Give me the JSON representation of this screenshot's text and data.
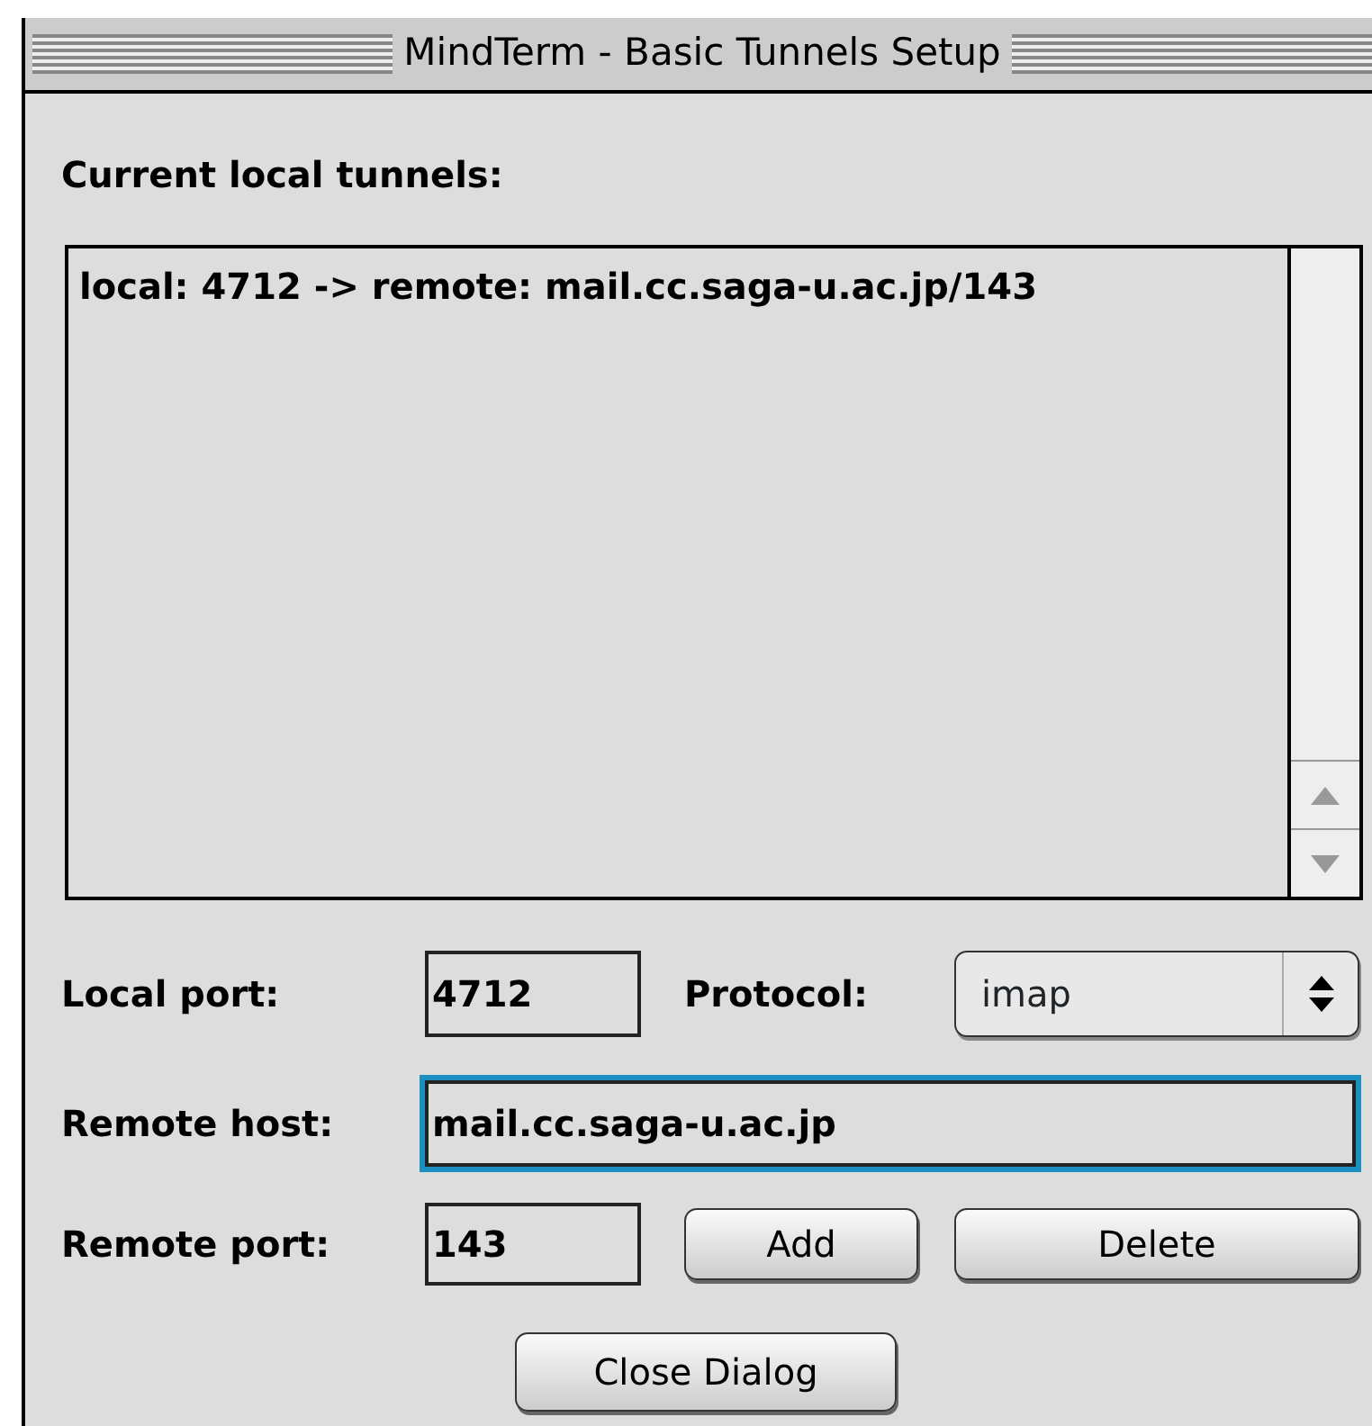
{
  "window": {
    "title": "MindTerm - Basic Tunnels Setup"
  },
  "tunnels_label": "Current local tunnels:",
  "tunnels": [
    "local: 4712 -> remote: mail.cc.saga-u.ac.jp/143"
  ],
  "local_port": {
    "label": "Local port:",
    "value": "4712"
  },
  "protocol": {
    "label": "Protocol:",
    "value": "imap"
  },
  "remote_host": {
    "label": "Remote host:",
    "value": "mail.cc.saga-u.ac.jp",
    "focused": true
  },
  "remote_port": {
    "label": "Remote port:",
    "value": "143"
  },
  "buttons": [
    "Add",
    "Delete"
  ],
  "close_button": "Close Dialog"
}
